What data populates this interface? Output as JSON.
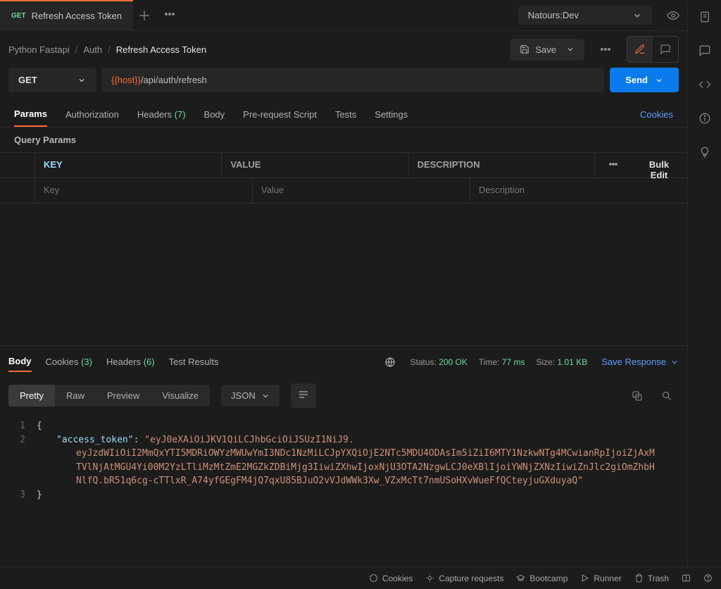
{
  "tab": {
    "method": "GET",
    "title": "Refresh Access Token"
  },
  "env": {
    "name": "Natours:Dev"
  },
  "breadcrumb": {
    "a": "Python Fastapi",
    "b": "Auth",
    "c": "Refresh Access Token"
  },
  "toolbar": {
    "save": "Save",
    "send": "Send"
  },
  "url": {
    "method": "GET",
    "var": "{{host}}",
    "path": "/api/auth/refresh"
  },
  "subtabs": {
    "params": "Params",
    "authorization": "Authorization",
    "headers": "Headers",
    "headers_count": "(7)",
    "body": "Body",
    "prereq": "Pre-request Script",
    "tests": "Tests",
    "settings": "Settings",
    "cookies": "Cookies"
  },
  "query_label": "Query Params",
  "params_table": {
    "h_key": "KEY",
    "h_value": "VALUE",
    "h_desc": "DESCRIPTION",
    "bulk": "Bulk Edit",
    "ph_key": "Key",
    "ph_value": "Value",
    "ph_desc": "Description"
  },
  "response_tabs": {
    "body": "Body",
    "cookies": "Cookies",
    "cookies_count": "(3)",
    "headers": "Headers",
    "headers_count": "(6)",
    "test_results": "Test Results"
  },
  "status": {
    "label": "Status:",
    "code": "200 OK",
    "time_label": "Time:",
    "time_value": "77 ms",
    "size_label": "Size:",
    "size_value": "1.01 KB"
  },
  "save_response": "Save Response",
  "format_tabs": {
    "pretty": "Pretty",
    "raw": "Raw",
    "preview": "Preview",
    "visualize": "Visualize",
    "type": "JSON"
  },
  "json": {
    "key": "\"access_token\"",
    "line1": "\"eyJ0eXAiOiJKV1QiLCJhbGciOiJSUzI1NiJ9.",
    "line2": "eyJzdWIiOiI2MmQxYTI5MDRiOWYzMWUwYmI3NDc1NzMiLCJpYXQiOjE2NTc5MDU4ODAsIm5iZiI6MTY1NzkwNTg4MCwianRpIjoiZjAxM",
    "line3": "TVlNjAtMGU4Yi00M2YzLTliMzMtZmE2MGZkZDBiMjg3IiwiZXhwIjoxNjU3OTA2NzgwLCJ0eXBlIjoiYWNjZXNzIiwiZnJlc2giOmZhbH",
    "line4": "NlfQ.bR51q6cg-cTTlxR_A74yfGEgFM4jQ7qxU85BJuO2vVJdWWk3Xw_VZxMcTt7nmUSoHXvWueFfQCteyjuGXduyaQ\""
  },
  "statusbar": {
    "cookies": "Cookies",
    "capture": "Capture requests",
    "bootcamp": "Bootcamp",
    "runner": "Runner",
    "trash": "Trash"
  }
}
